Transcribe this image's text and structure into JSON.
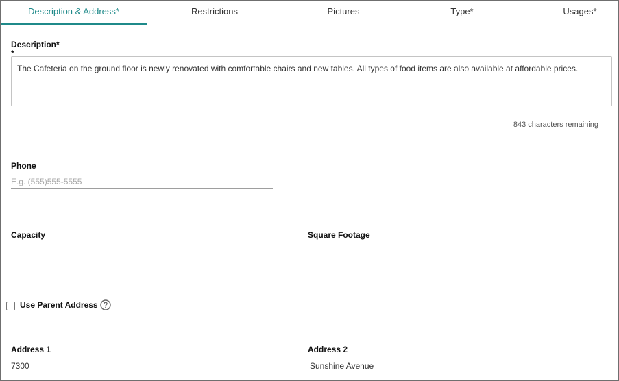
{
  "tabs": [
    {
      "label": "Description & Address*",
      "active": true
    },
    {
      "label": "Restrictions",
      "active": false
    },
    {
      "label": "Pictures",
      "active": false
    },
    {
      "label": "Type*",
      "active": false
    },
    {
      "label": "Usages*",
      "active": false
    }
  ],
  "description": {
    "label": "Description*",
    "required_mark": "*",
    "value": "The Cafeteria on the ground floor is newly renovated with comfortable chairs and new tables. All types of food items are also available at affordable prices.",
    "remaining_text": "843 characters remaining"
  },
  "phone": {
    "label": "Phone",
    "value": "",
    "placeholder": "E.g. (555)555-5555"
  },
  "capacity": {
    "label": "Capacity",
    "value": ""
  },
  "square_footage": {
    "label": "Square Footage",
    "value": ""
  },
  "use_parent_address": {
    "label": "Use Parent Address",
    "checked": false,
    "help_icon": "question-circle-icon"
  },
  "address1": {
    "label": "Address 1",
    "value": "7300"
  },
  "address2": {
    "label": "Address 2",
    "value": "Sunshine Avenue"
  },
  "colors": {
    "accent": "#1f8a8a",
    "border": "#c4c4c4"
  }
}
